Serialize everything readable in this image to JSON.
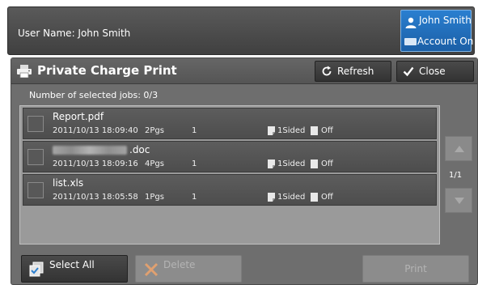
{
  "header": {
    "user_name_text": "User Name: John Smith",
    "user_label": "John Smith",
    "account_label": "Account On"
  },
  "panel": {
    "title": "Private Charge Print",
    "refresh_label": "Refresh",
    "close_label": "Close",
    "selected_count": "Number of selected jobs: 0/3"
  },
  "jobs": [
    {
      "name": "Report.pdf",
      "datetime": "2011/10/13 18:09:40",
      "pages": "2Pgs",
      "copies": "1",
      "sided": "1Sided",
      "staple": "Off",
      "name_blurred": false
    },
    {
      "name": ".doc",
      "datetime": "2011/10/13 18:09:16",
      "pages": "4Pgs",
      "copies": "1",
      "sided": "1Sided",
      "staple": "Off",
      "name_blurred": true
    },
    {
      "name": "list.xls",
      "datetime": "2011/10/13 18:05:58",
      "pages": "1Pgs",
      "copies": "1",
      "sided": "1Sided",
      "staple": "Off",
      "name_blurred": false
    }
  ],
  "pagination": "1/1",
  "actions": {
    "select_all_label": "Select All",
    "delete_label": "Delete",
    "print_label": "Print"
  },
  "icons": {
    "user": "person-icon",
    "account": "card-icon",
    "title": "printer-icon",
    "refresh": "refresh-icon",
    "close": "checkmark-icon",
    "select_all": "select-all-icon",
    "delete": "x-icon",
    "scroll_up": "triangle-up-icon",
    "scroll_down": "triangle-down-icon"
  },
  "colors": {
    "accent_blue": "#2a7fd0",
    "delete_x": "#e0a070"
  }
}
